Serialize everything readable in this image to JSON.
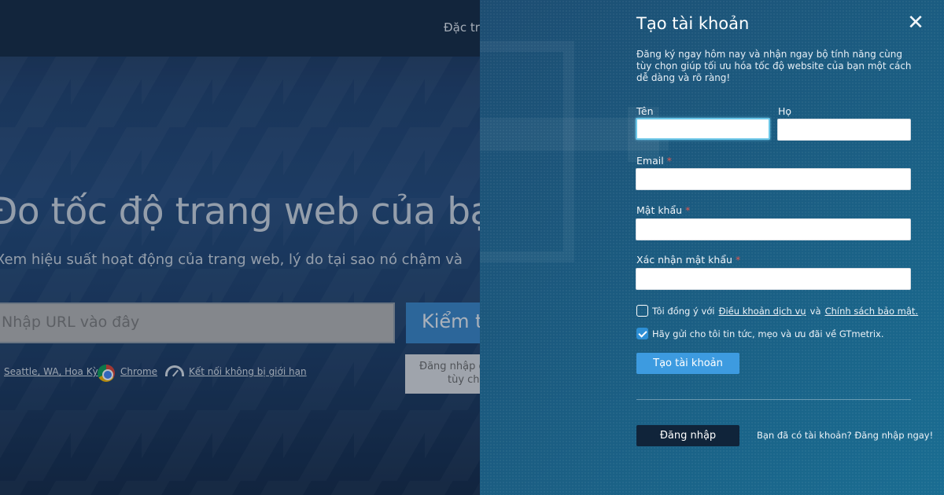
{
  "background": {
    "nav_item": "Đặc trư",
    "headline": "Đo tốc độ trang web của bạn",
    "subline": "Xem hiệu suất hoạt động của trang web, lý do tại sao nó chậm và",
    "url_placeholder": "Nhập URL vào đây",
    "analyze_button": "Kiểm tra",
    "location_link": "Seattle, WA, Hoa Kỳ",
    "browser_link": "Chrome",
    "connection_link": "Kết nối không bị giới hạn",
    "login_note": "Đăng nhập để\ntùy chỉnh"
  },
  "signup_panel": {
    "title": "Tạo tài khoản",
    "description": "Đăng ký ngay hôm nay và nhận ngay bộ tính năng cùng tùy chọn giúp tối ưu hóa tốc độ website của bạn một cách dễ dàng và rõ ràng!",
    "close_symbol": "✕",
    "fields": {
      "first_name_label": "Tên",
      "last_name_label": "Họ",
      "email_label": "Email",
      "password_label": "Mật khẩu",
      "confirm_password_label": "Xác nhận mật khẩu",
      "required_marker": "*",
      "first_name_value": "",
      "last_name_value": "",
      "email_value": "",
      "password_value": "",
      "confirm_password_value": ""
    },
    "terms": {
      "checked": false,
      "prefix": "Tôi đồng ý với",
      "tos_link": "Điều khoản dịch vụ",
      "joiner": "và",
      "privacy_link": "Chính sách bảo mật."
    },
    "newsletter": {
      "checked": true,
      "label": "Hãy gửi cho tôi tin tức, mẹo và ưu đãi về GTmetrix."
    },
    "create_button": "Tạo tài khoản",
    "login_button": "Đăng nhập",
    "login_hint": "Bạn đã có tài khoản? Đăng nhập ngay!"
  },
  "colors": {
    "panel_accent": "#3d9be0",
    "required": "#e0574f",
    "login_button": "#10243a"
  }
}
